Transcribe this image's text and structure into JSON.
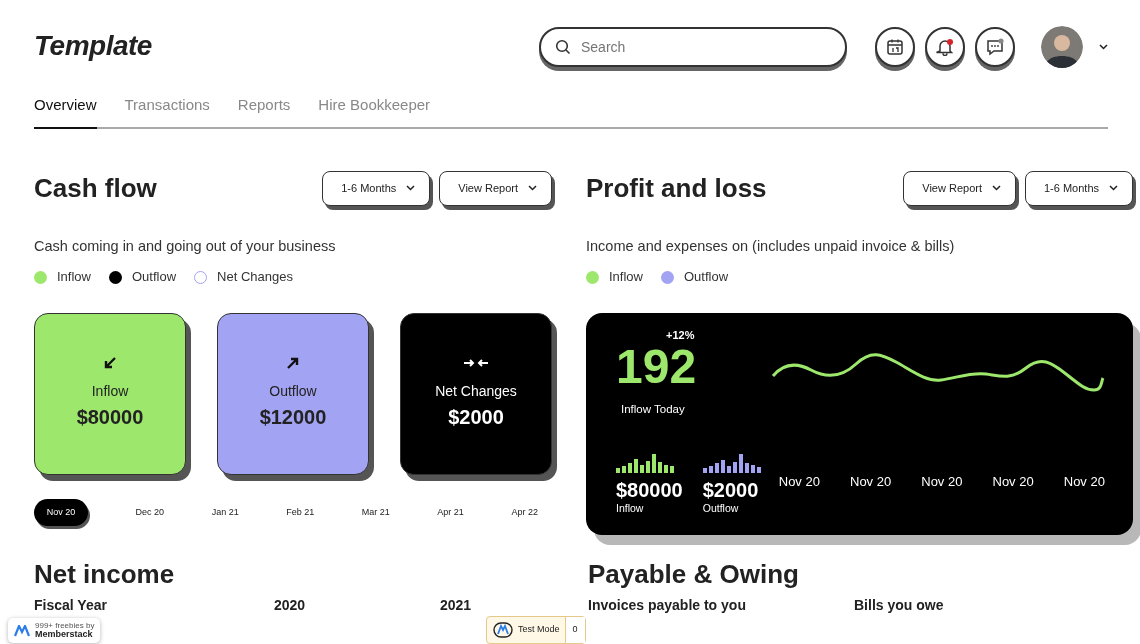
{
  "header": {
    "logo": "Template",
    "search": {
      "placeholder": "Search"
    },
    "notifications": {
      "bell_dot": true,
      "chat_dot": true
    }
  },
  "tabs": [
    {
      "label": "Overview",
      "selected": true
    },
    {
      "label": "Transactions",
      "selected": false
    },
    {
      "label": "Reports",
      "selected": false
    },
    {
      "label": "Hire Bookkeeper",
      "selected": false
    }
  ],
  "cash_flow": {
    "title": "Cash flow",
    "buttons": [
      "1-6 Months",
      "View Report"
    ],
    "subtitle": "Cash coming in and going out of your business",
    "legend": [
      {
        "label": "Inflow",
        "color": "#9de86c",
        "kind": "filled"
      },
      {
        "label": "Outflow",
        "color": "#000000",
        "kind": "filled"
      },
      {
        "label": "Net Changes",
        "color": "#a3a3f3",
        "kind": "ring"
      }
    ],
    "cards": [
      {
        "kind": "inflow",
        "label": "Inflow",
        "value": "$80000",
        "color": "#9de86c"
      },
      {
        "kind": "outflow",
        "label": "Outflow",
        "value": "$12000",
        "color": "#a3a3f3"
      },
      {
        "kind": "net",
        "label": "Net Changes",
        "value": "$2000",
        "color": "#000000"
      }
    ],
    "timeline": [
      {
        "label": "Nov 20",
        "selected": true
      },
      {
        "label": "Dec 20",
        "selected": false
      },
      {
        "label": "Jan 21",
        "selected": false
      },
      {
        "label": "Feb 21",
        "selected": false
      },
      {
        "label": "Mar 21",
        "selected": false
      },
      {
        "label": "Apr 21",
        "selected": false
      },
      {
        "label": "Apr 22",
        "selected": false
      }
    ]
  },
  "profit_loss": {
    "title": "Profit and loss",
    "buttons": [
      "View Report",
      "1-6 Months"
    ],
    "subtitle": "Income and expenses on (includes unpaid invoice & bills)",
    "legend": [
      {
        "label": "Inflow",
        "color": "#9de86c"
      },
      {
        "label": "Outflow",
        "color": "#a3a3f3"
      }
    ],
    "highlight": {
      "change": "+12%",
      "value": "192",
      "label": "Inflow Today"
    },
    "stats": [
      {
        "value": "$80000",
        "label": "Inflow",
        "color": "#9de86c"
      },
      {
        "value": "$2000",
        "label": "Outflow",
        "color": "#a3a3f3"
      }
    ],
    "dates": [
      "Nov 20",
      "Nov 20",
      "Nov 20",
      "Nov 20",
      "Nov 20"
    ]
  },
  "net_income": {
    "title": "Net income",
    "columns": [
      "Fiscal Year",
      "2020",
      "2021"
    ]
  },
  "payable_owing": {
    "title": "Payable & Owing",
    "columns": [
      "Invoices payable to you",
      "Bills you owe"
    ]
  },
  "memberstack_badge": {
    "line_1": "999+ freebies by",
    "line_2": "Memberstack"
  },
  "test_mode": {
    "label": "Test Mode",
    "count": "0"
  }
}
